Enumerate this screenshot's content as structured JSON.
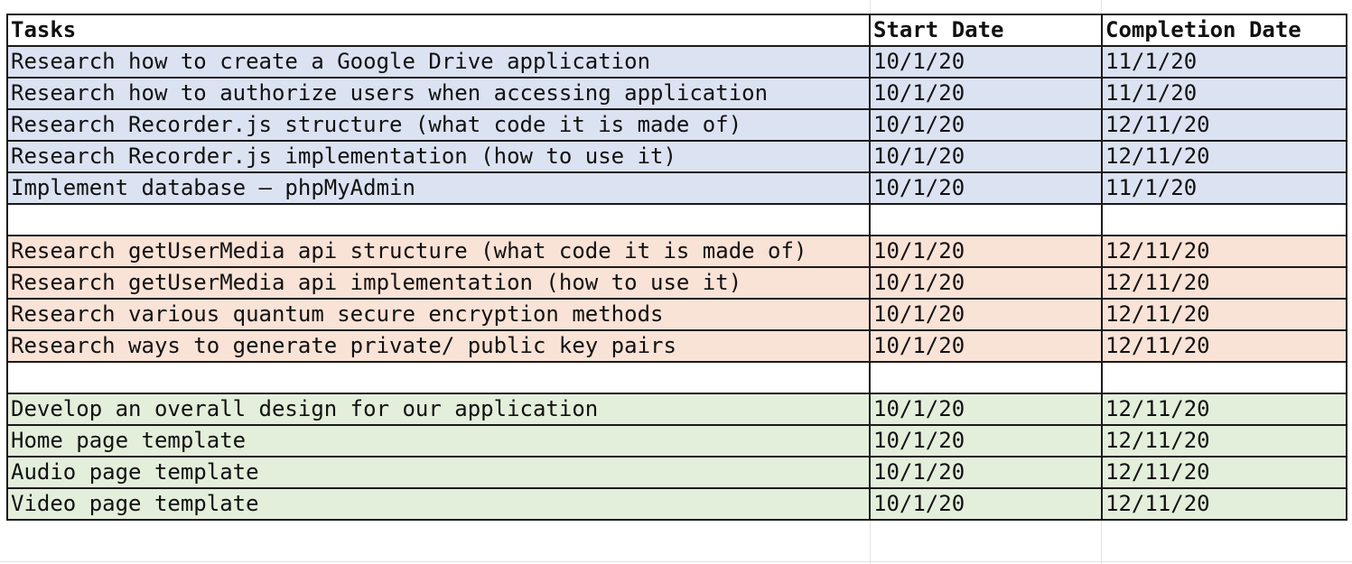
{
  "headers": {
    "task": "Tasks",
    "start": "Start Date",
    "completion": "Completion Date"
  },
  "colors": {
    "group_blue": "#dbe2f1",
    "group_orange": "#f9e2d6",
    "group_green": "#e3eedb"
  },
  "rows": [
    {
      "task": "Research how to create a Google Drive application",
      "start": "10/1/20",
      "completion": "11/1/20"
    },
    {
      "task": "Research how to authorize users when accessing application",
      "start": "10/1/20",
      "completion": "11/1/20"
    },
    {
      "task": "Research Recorder.js structure (what code it is made of)",
      "start": "10/1/20",
      "completion": "12/11/20"
    },
    {
      "task": "Research Recorder.js implementation (how to use it)",
      "start": "10/1/20",
      "completion": "12/11/20"
    },
    {
      "task": "Implement database – phpMyAdmin",
      "start": "10/1/20",
      "completion": "11/1/20"
    },
    {
      "task": "",
      "start": "",
      "completion": ""
    },
    {
      "task": "Research getUserMedia api structure (what code it is made of)",
      "start": "10/1/20",
      "completion": "12/11/20"
    },
    {
      "task": "Research getUserMedia api implementation (how to use it)",
      "start": "10/1/20",
      "completion": "12/11/20"
    },
    {
      "task": "Research various quantum secure encryption methods",
      "start": "10/1/20",
      "completion": "12/11/20"
    },
    {
      "task": "Research ways to generate private/ public key pairs",
      "start": "10/1/20",
      "completion": "12/11/20"
    },
    {
      "task": "",
      "start": "",
      "completion": ""
    },
    {
      "task": "Develop an overall design for our application",
      "start": "10/1/20",
      "completion": "12/11/20"
    },
    {
      "task": "Home page template",
      "start": "10/1/20",
      "completion": "12/11/20"
    },
    {
      "task": "Audio page template",
      "start": "10/1/20",
      "completion": "12/11/20"
    },
    {
      "task": "Video page template",
      "start": "10/1/20",
      "completion": "12/11/20"
    }
  ]
}
